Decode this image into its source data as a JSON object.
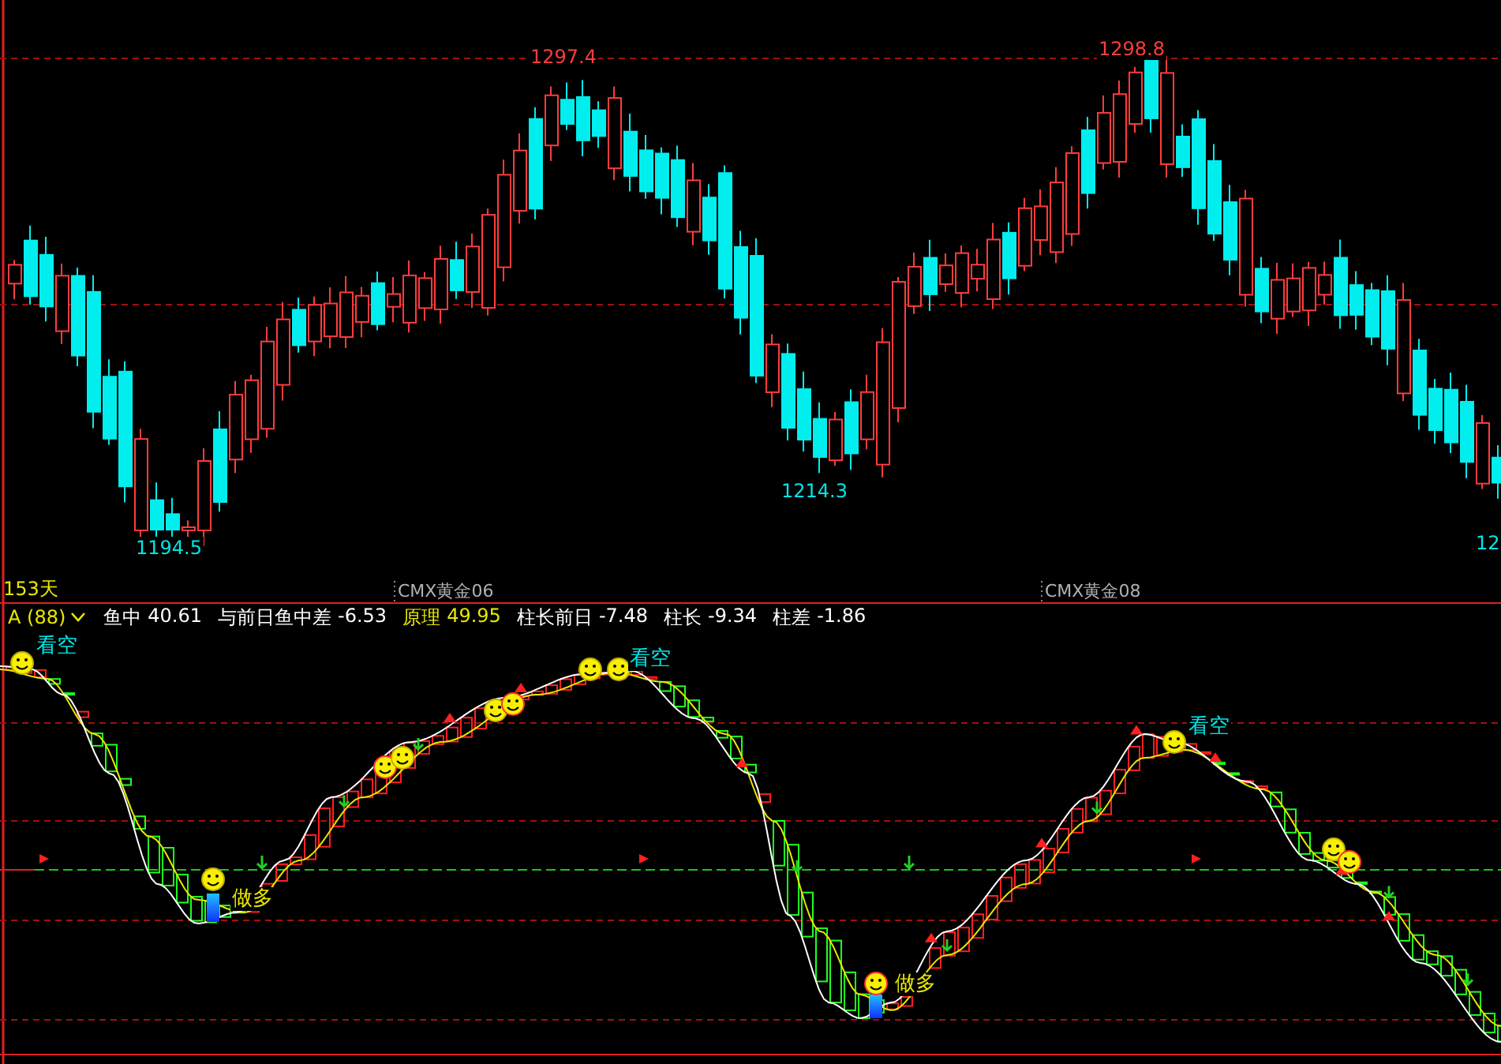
{
  "price_chart": {
    "extreme_labels": [
      {
        "text": "1297.4",
        "kind": "high"
      },
      {
        "text": "1298.8",
        "kind": "high"
      },
      {
        "text": "1194.5",
        "kind": "low"
      },
      {
        "text": "1214.3",
        "kind": "low"
      },
      {
        "text": "12",
        "kind": "low"
      }
    ],
    "period_label": "153天",
    "contract_labels": [
      "CMX黄金06",
      "CMX黄金08"
    ]
  },
  "indicator": {
    "name": "A (88)",
    "readings": [
      {
        "label": "鱼中",
        "value": "40.61",
        "kind": "normal"
      },
      {
        "label": "与前日鱼中差",
        "value": "-6.53",
        "kind": "normal"
      },
      {
        "label": "原理",
        "value": "49.95",
        "kind": "highlight"
      },
      {
        "label": "柱长前日",
        "value": "-7.48",
        "kind": "normal"
      },
      {
        "label": "柱长",
        "value": "-9.34",
        "kind": "normal"
      },
      {
        "label": "柱差",
        "value": "-1.86",
        "kind": "normal"
      }
    ],
    "signals": [
      {
        "text": "看空",
        "kind": "bear"
      },
      {
        "text": "做多",
        "kind": "bull"
      },
      {
        "text": "看空",
        "kind": "bear"
      },
      {
        "text": "做多",
        "kind": "bull"
      },
      {
        "text": "看空",
        "kind": "bear"
      }
    ]
  }
}
